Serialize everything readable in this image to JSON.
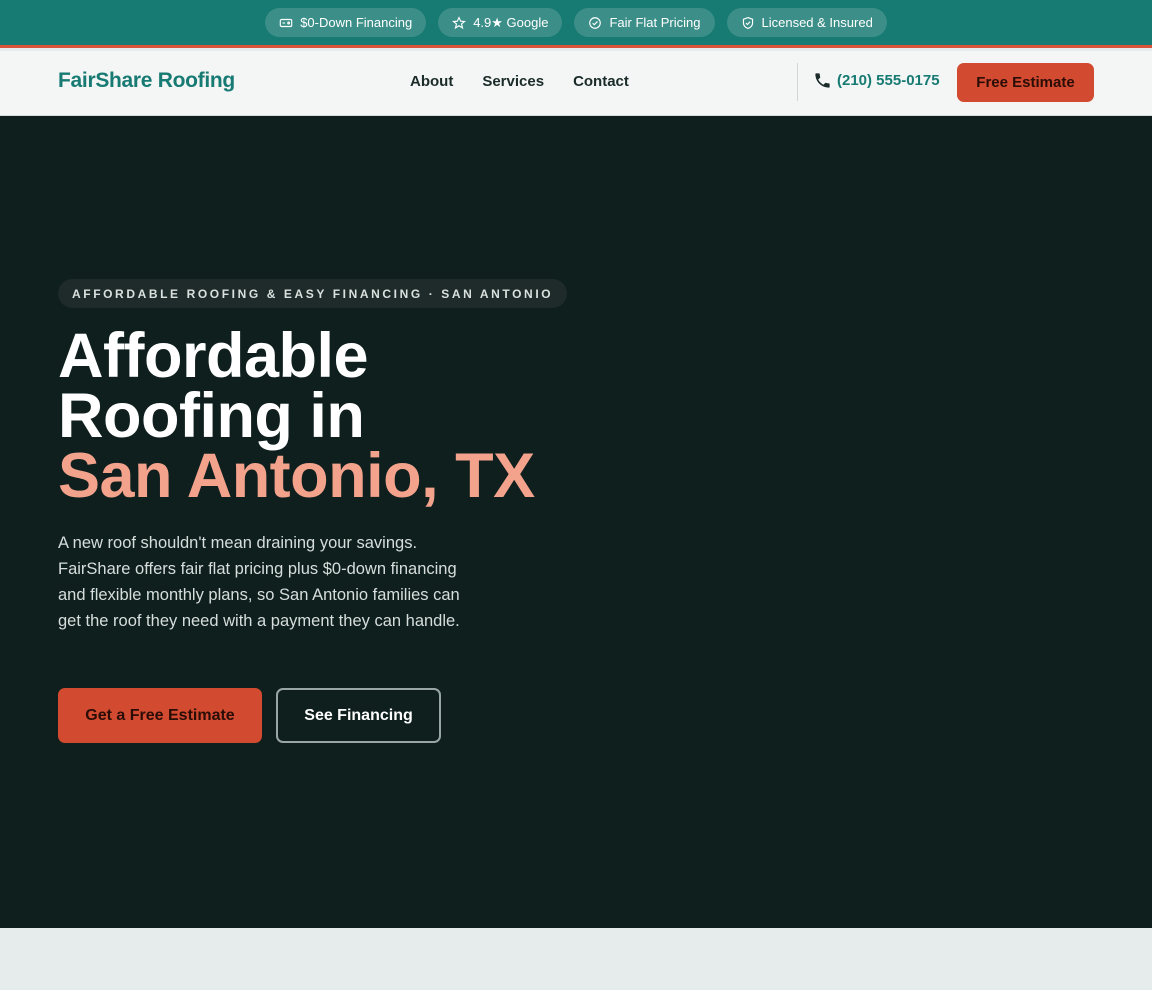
{
  "topbar": {
    "badges": [
      {
        "label": "$0-Down Financing",
        "icon": "card-icon"
      },
      {
        "label": "4.9★ Google",
        "icon": "star-icon"
      },
      {
        "label": "Fair Flat Pricing",
        "icon": "check-circle-icon"
      },
      {
        "label": "Licensed & Insured",
        "icon": "shield-icon"
      }
    ]
  },
  "nav": {
    "brand": "FairShare Roofing",
    "links": [
      "About",
      "Services",
      "Contact"
    ],
    "phone": "(210) 555-0175",
    "cta": "Free Estimate"
  },
  "hero": {
    "eyebrow": "AFFORDABLE ROOFING & EASY FINANCING · SAN ANTONIO",
    "headline_line1": "Affordable",
    "headline_line2": "Roofing in",
    "headline_accent": "San Antonio, TX",
    "lead": "A new roof shouldn't mean draining your savings. FairShare offers fair flat pricing plus $0-down financing and flexible monthly plans, so San Antonio families can get the roof they need with a payment they can handle.",
    "primary_button": "Get a Free Estimate",
    "secondary_button": "See Financing"
  },
  "colors": {
    "teal": "#177a73",
    "accent_orange": "#d24a30",
    "hero_bg": "#0f1f1e",
    "headline_accent": "#f3a28c"
  }
}
